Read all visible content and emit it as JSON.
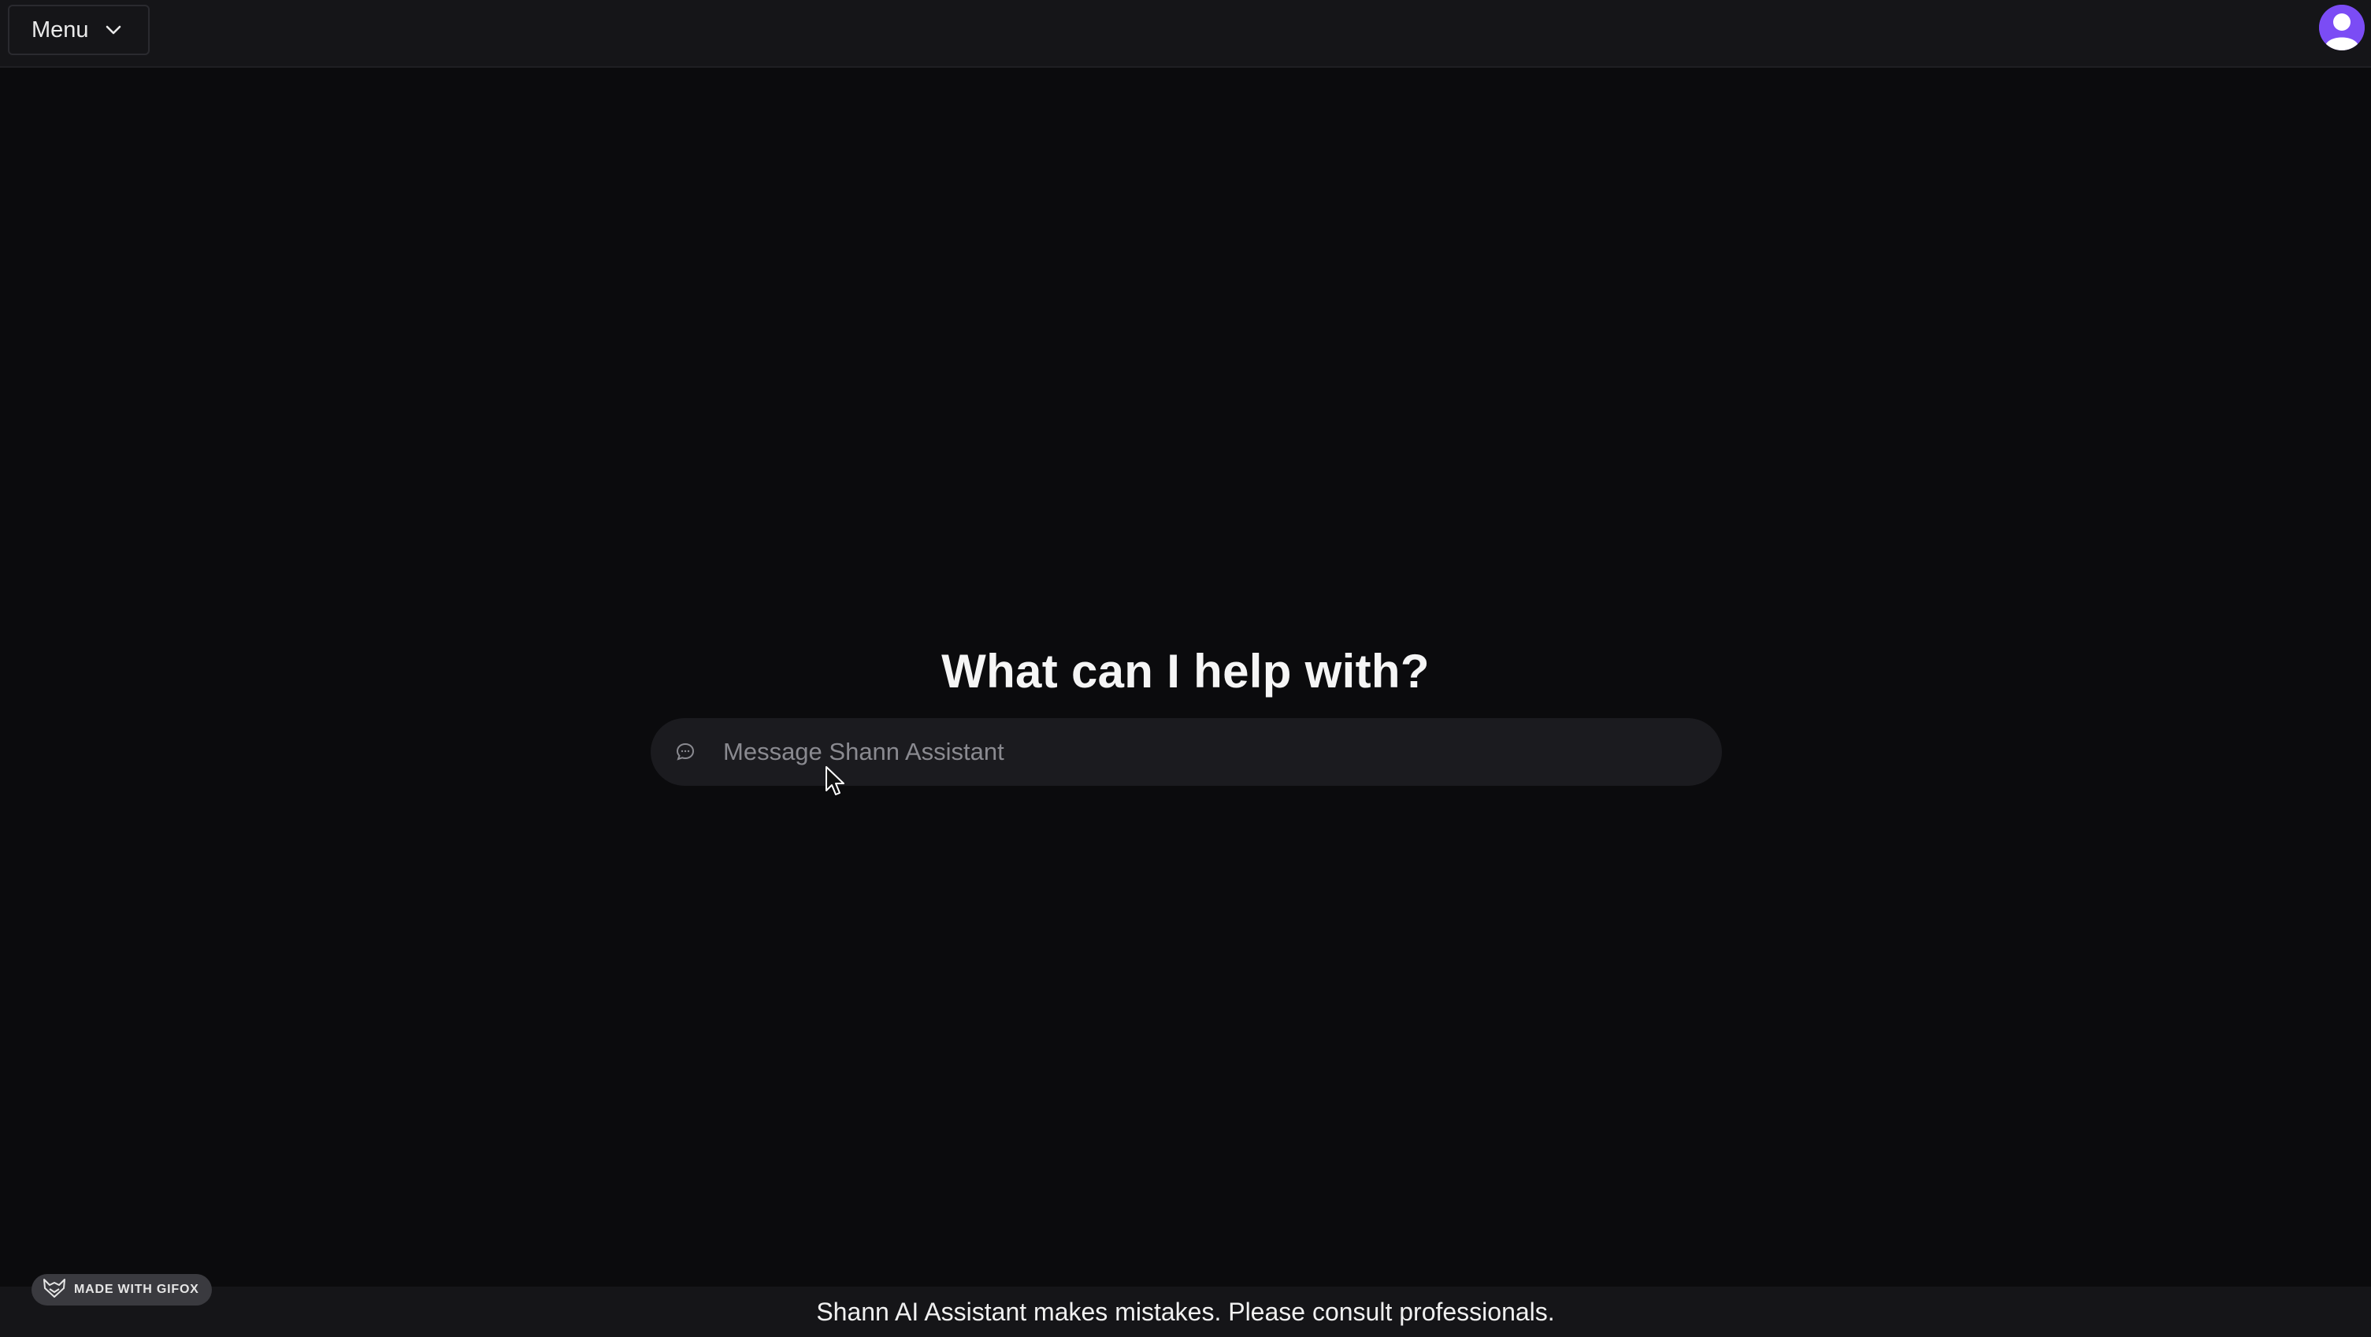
{
  "header": {
    "menu_label": "Menu"
  },
  "main": {
    "heading": "What can I help with?",
    "composer": {
      "value": "",
      "placeholder": "Message Shann Assistant"
    }
  },
  "footer": {
    "disclaimer": "Shann AI Assistant makes mistakes. Please consult professionals."
  },
  "watermark": {
    "label": "MADE WITH GIFOX"
  },
  "icons": {
    "menu": "chevron-down-icon",
    "avatar": "user-avatar-icon",
    "composer": "chat-bubble-icon",
    "watermark": "fox-logo-icon"
  },
  "colors": {
    "background": "#0b0b0d",
    "topbar": "#151518",
    "composer": "#1b1b1f",
    "avatar": "#7b4cf5"
  }
}
